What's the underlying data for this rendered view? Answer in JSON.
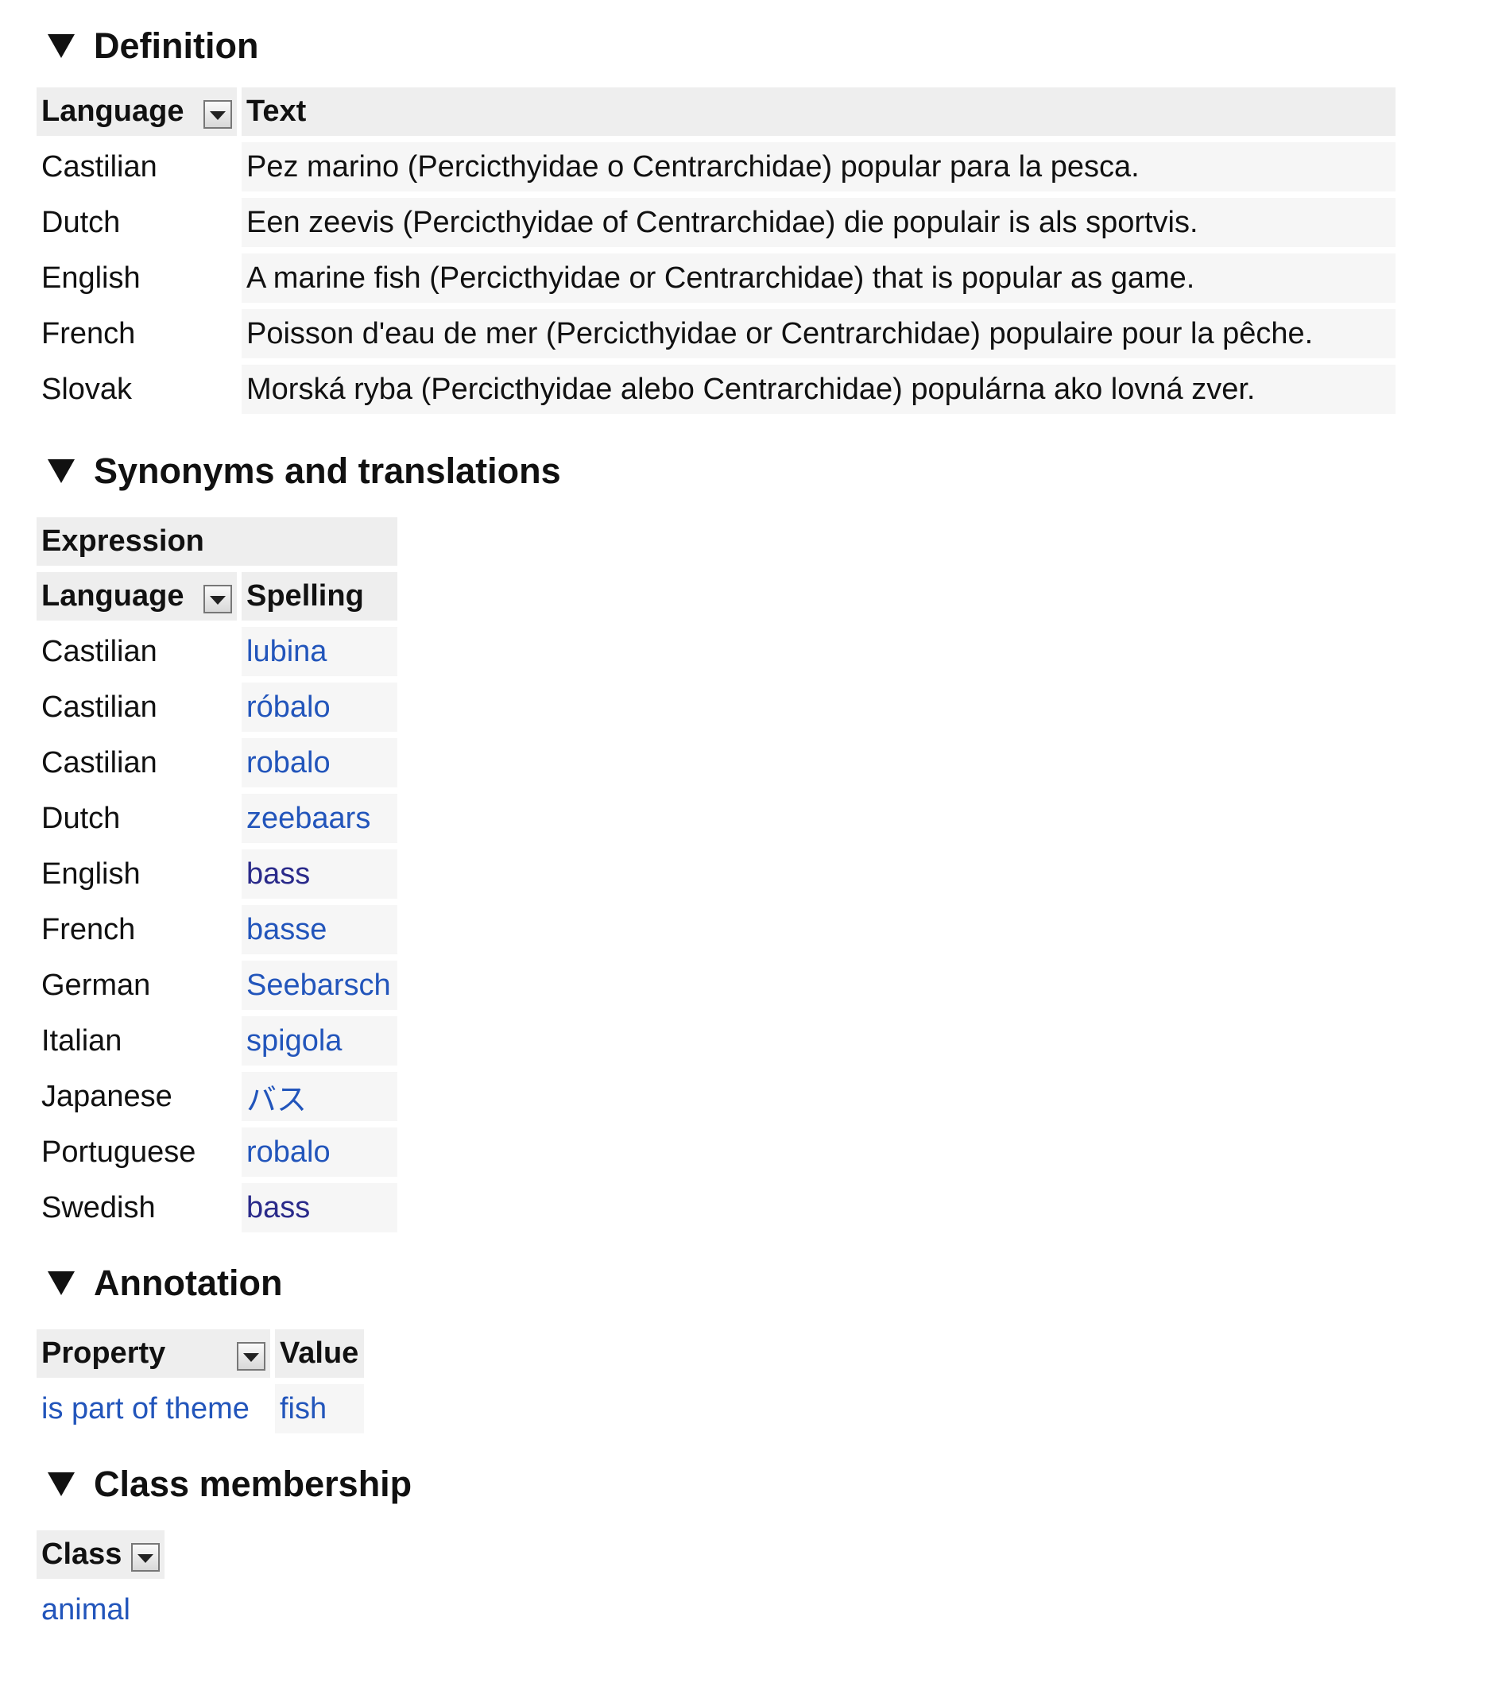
{
  "definition": {
    "heading": "Definition",
    "columns": {
      "language": "Language",
      "text": "Text"
    },
    "rows": [
      {
        "language": "Castilian",
        "text": "Pez marino (Percicthyidae o Centrarchidae) popular para la pesca."
      },
      {
        "language": "Dutch",
        "text": "Een zeevis (Percicthyidae of Centrarchidae) die populair is als sportvis."
      },
      {
        "language": "English",
        "text": "A marine fish (Percicthyidae or Centrarchidae) that is popular as game."
      },
      {
        "language": "French",
        "text": "Poisson d'eau de mer (Percicthyidae or Centrarchidae) populaire pour la pêche."
      },
      {
        "language": "Slovak",
        "text": "Morská ryba (Percicthyidae alebo Centrarchidae) populárna ako lovná zver."
      }
    ]
  },
  "synonyms": {
    "heading": "Synonyms and translations",
    "group_header": "Expression",
    "columns": {
      "language": "Language",
      "spelling": "Spelling"
    },
    "rows": [
      {
        "language": "Castilian",
        "spelling": "lubina"
      },
      {
        "language": "Castilian",
        "spelling": "róbalo"
      },
      {
        "language": "Castilian",
        "spelling": "robalo"
      },
      {
        "language": "Dutch",
        "spelling": "zeebaars"
      },
      {
        "language": "English",
        "spelling": "bass"
      },
      {
        "language": "French",
        "spelling": "basse"
      },
      {
        "language": "German",
        "spelling": "Seebarsch"
      },
      {
        "language": "Italian",
        "spelling": "spigola"
      },
      {
        "language": "Japanese",
        "spelling": "バス"
      },
      {
        "language": "Portuguese",
        "spelling": "robalo"
      },
      {
        "language": "Swedish",
        "spelling": "bass"
      }
    ]
  },
  "annotation": {
    "heading": "Annotation",
    "columns": {
      "property": "Property",
      "value": "Value"
    },
    "rows": [
      {
        "property": "is part of theme",
        "value": "fish"
      }
    ]
  },
  "class_membership": {
    "heading": "Class membership",
    "columns": {
      "class": "Class"
    },
    "rows": [
      {
        "class": "animal"
      }
    ]
  },
  "colors": {
    "link": "#2255bb",
    "visited_link": "#2a2a8a",
    "header_bg": "#eeeeee",
    "cell_bg": "#f6f6f6"
  },
  "icons": {
    "section_toggle": "triangle-down-icon",
    "column_sort": "dropdown-arrow-icon"
  }
}
